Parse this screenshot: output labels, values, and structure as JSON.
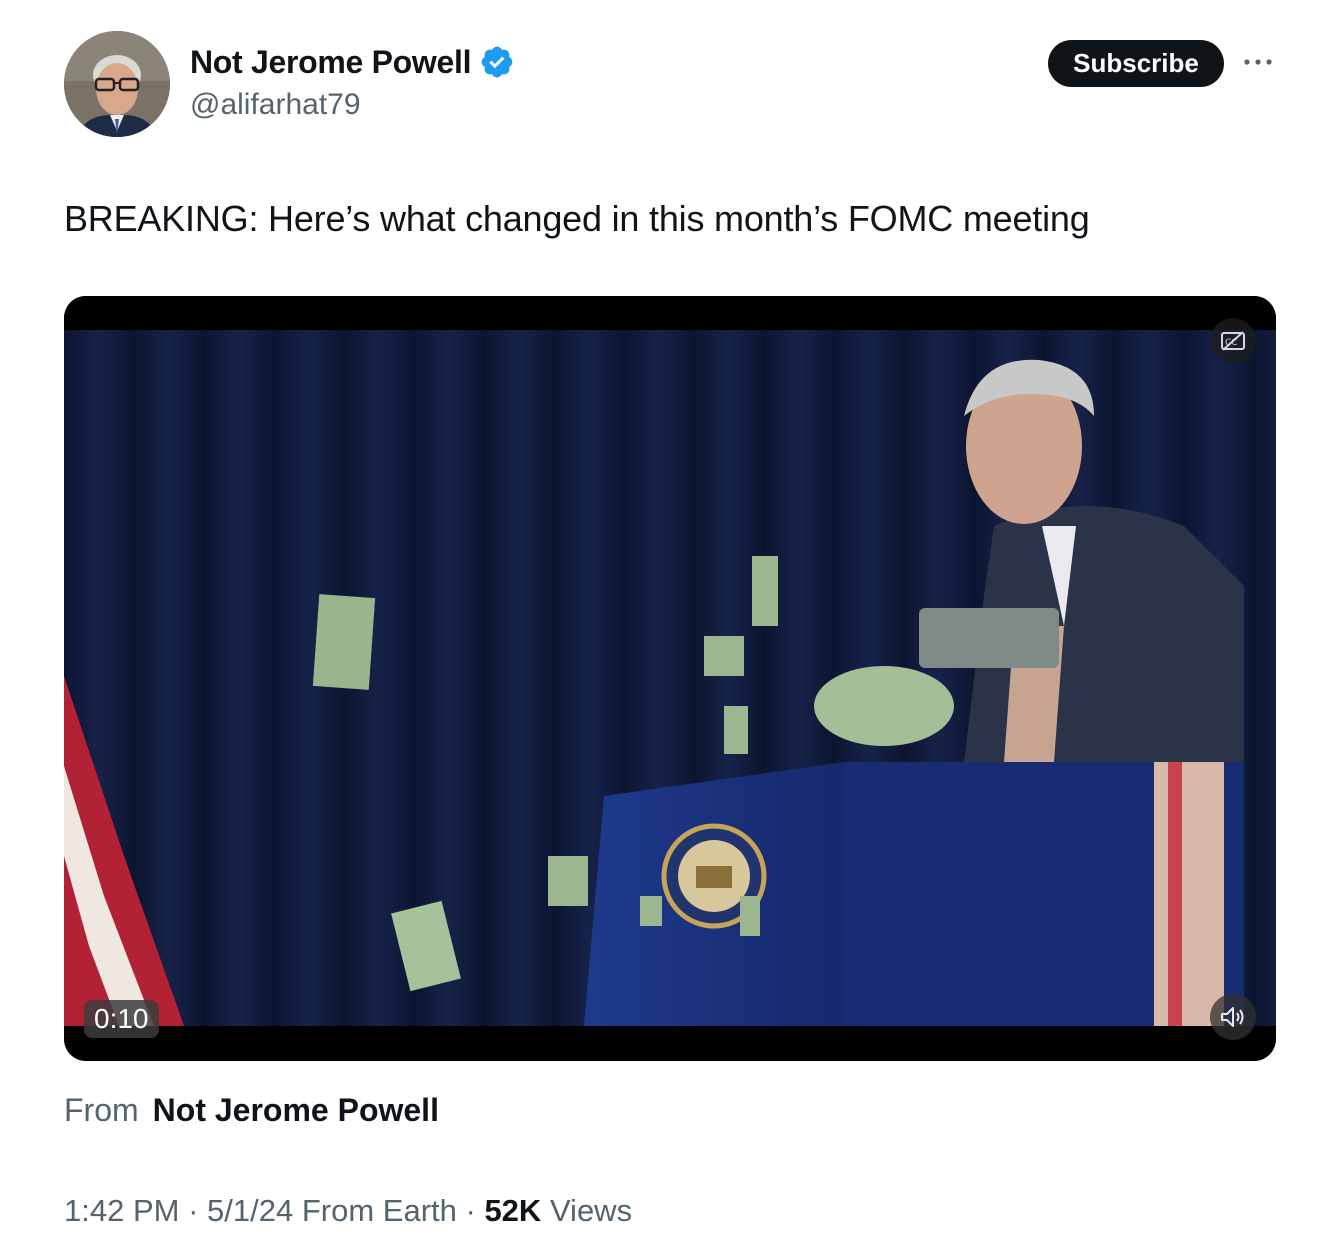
{
  "author": {
    "name": "Not Jerome Powell",
    "handle": "@alifarhat79",
    "verified": true,
    "avatar": "profile-photo"
  },
  "actions": {
    "subscribe_label": "Subscribe",
    "more_icon": "more-horizontal-icon"
  },
  "tweet": {
    "text": "BREAKING: Here’s what changed in this month’s FOMC meeting"
  },
  "video": {
    "duration": "0:10",
    "captions_icon": "closed-captions-off-icon",
    "volume_icon": "volume-icon"
  },
  "source": {
    "from_label": "From",
    "from_name": "Not Jerome Powell"
  },
  "meta": {
    "time": "1:42 PM",
    "date": "5/1/24",
    "location": "From Earth",
    "sep1": " · ",
    "sep2": " · ",
    "sep3": " · ",
    "views_count": "52K",
    "views_label": "Views"
  },
  "colors": {
    "text": "#0f1419",
    "secondary": "#536471",
    "verified_blue": "#1d9bf0",
    "button_bg": "#0f1419"
  }
}
